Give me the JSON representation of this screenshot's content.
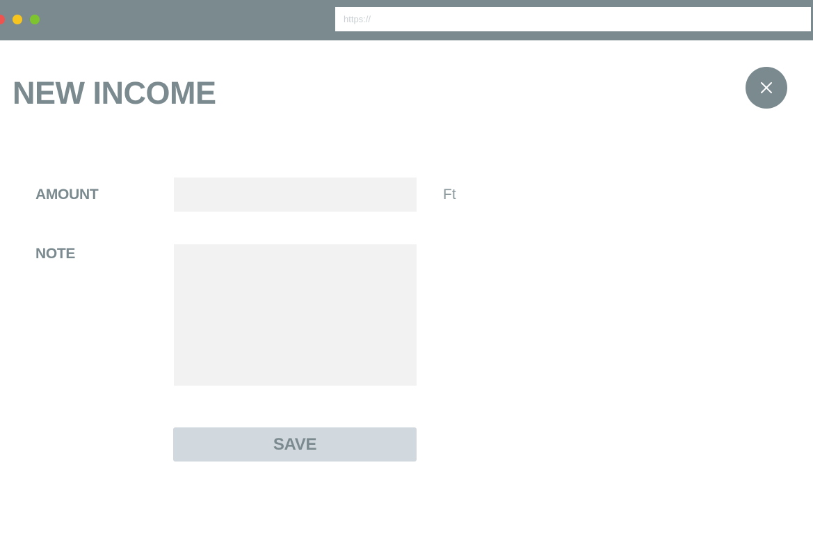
{
  "browser": {
    "url_placeholder": "https://",
    "url_value": ""
  },
  "page": {
    "title": "NEW INCOME",
    "close_icon": "close-icon"
  },
  "form": {
    "amount_label": "AMOUNT",
    "amount_value": "",
    "currency": "Ft",
    "note_label": "NOTE",
    "note_value": "",
    "save_label": "SAVE"
  },
  "colors": {
    "accent": "#7b8a8f",
    "input_background": "#f2f2f2",
    "button_background": "#d1d8de",
    "dot_red": "#ef5350",
    "dot_yellow": "#f7c51e",
    "dot_green": "#7dc42e"
  }
}
